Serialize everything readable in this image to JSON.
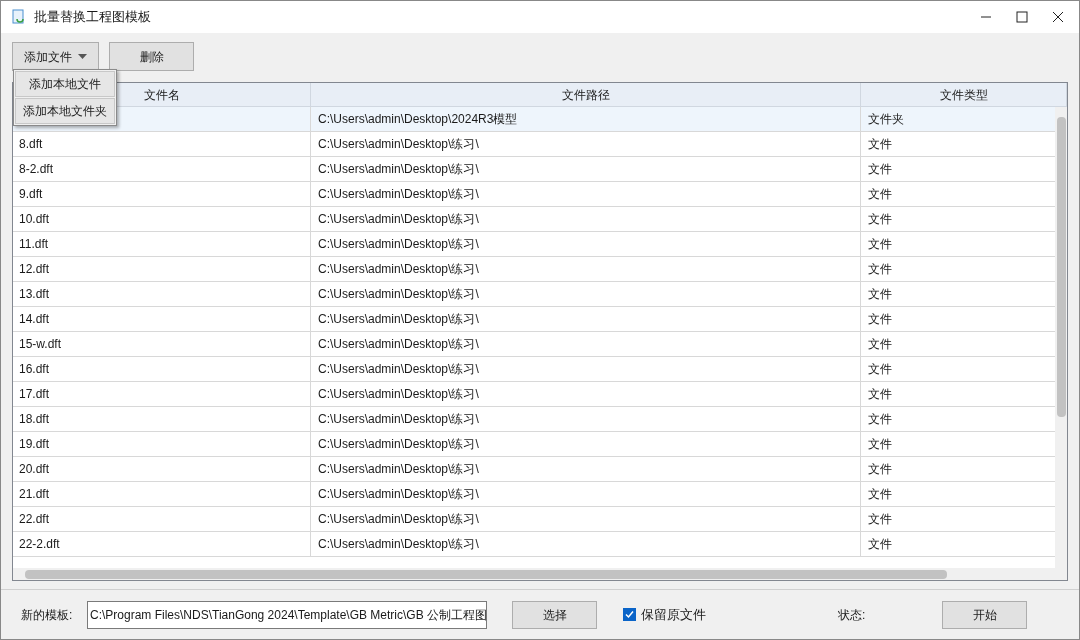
{
  "window": {
    "title": "批量替换工程图模板"
  },
  "toolbar": {
    "add_button": "添加文件",
    "delete_button": "删除"
  },
  "add_menu": {
    "open": true,
    "items": [
      "添加本地文件",
      "添加本地文件夹"
    ]
  },
  "table": {
    "columns": [
      "文件名",
      "文件路径",
      "文件类型"
    ],
    "rows": [
      {
        "name": "",
        "path": "C:\\Users\\admin\\Desktop\\2024R3模型",
        "type": "文件夹",
        "selected": true
      },
      {
        "name": "8.dft",
        "path": "C:\\Users\\admin\\Desktop\\练习\\",
        "type": "文件",
        "selected": false
      },
      {
        "name": "8-2.dft",
        "path": "C:\\Users\\admin\\Desktop\\练习\\",
        "type": "文件",
        "selected": false
      },
      {
        "name": "9.dft",
        "path": "C:\\Users\\admin\\Desktop\\练习\\",
        "type": "文件",
        "selected": false
      },
      {
        "name": "10.dft",
        "path": "C:\\Users\\admin\\Desktop\\练习\\",
        "type": "文件",
        "selected": false
      },
      {
        "name": "11.dft",
        "path": "C:\\Users\\admin\\Desktop\\练习\\",
        "type": "文件",
        "selected": false
      },
      {
        "name": "12.dft",
        "path": "C:\\Users\\admin\\Desktop\\练习\\",
        "type": "文件",
        "selected": false
      },
      {
        "name": "13.dft",
        "path": "C:\\Users\\admin\\Desktop\\练习\\",
        "type": "文件",
        "selected": false
      },
      {
        "name": "14.dft",
        "path": "C:\\Users\\admin\\Desktop\\练习\\",
        "type": "文件",
        "selected": false
      },
      {
        "name": "15-w.dft",
        "path": "C:\\Users\\admin\\Desktop\\练习\\",
        "type": "文件",
        "selected": false
      },
      {
        "name": "16.dft",
        "path": "C:\\Users\\admin\\Desktop\\练习\\",
        "type": "文件",
        "selected": false
      },
      {
        "name": "17.dft",
        "path": "C:\\Users\\admin\\Desktop\\练习\\",
        "type": "文件",
        "selected": false
      },
      {
        "name": "18.dft",
        "path": "C:\\Users\\admin\\Desktop\\练习\\",
        "type": "文件",
        "selected": false
      },
      {
        "name": "19.dft",
        "path": "C:\\Users\\admin\\Desktop\\练习\\",
        "type": "文件",
        "selected": false
      },
      {
        "name": "20.dft",
        "path": "C:\\Users\\admin\\Desktop\\练习\\",
        "type": "文件",
        "selected": false
      },
      {
        "name": "21.dft",
        "path": "C:\\Users\\admin\\Desktop\\练习\\",
        "type": "文件",
        "selected": false
      },
      {
        "name": "22.dft",
        "path": "C:\\Users\\admin\\Desktop\\练习\\",
        "type": "文件",
        "selected": false
      },
      {
        "name": "22-2.dft",
        "path": "C:\\Users\\admin\\Desktop\\练习\\",
        "type": "文件",
        "selected": false
      }
    ]
  },
  "bottom": {
    "template_label": "新的模板:",
    "template_value": "C:\\Program Files\\NDS\\TianGong 2024\\Template\\GB Metric\\GB 公制工程图",
    "choose_button": "选择",
    "keep_original": {
      "label": "保留原文件",
      "checked": true
    },
    "status_label": "状态:",
    "start_button": "开始"
  }
}
